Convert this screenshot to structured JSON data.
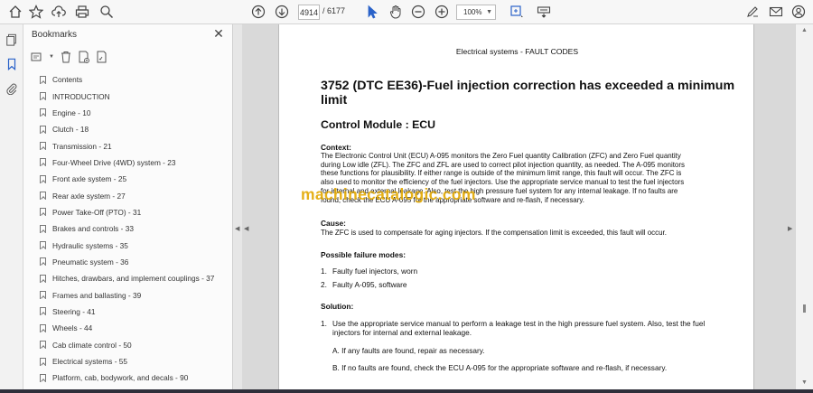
{
  "toolbar": {
    "page_current": "4914",
    "page_total": "/ 6177",
    "zoom": "100%"
  },
  "bookmarks": {
    "title": "Bookmarks",
    "items": [
      "Contents",
      "INTRODUCTION",
      "Engine - 10",
      "Clutch - 18",
      "Transmission - 21",
      "Four-Wheel Drive (4WD) system - 23",
      "Front axle system - 25",
      "Rear axle system - 27",
      "Power Take-Off (PTO) - 31",
      "Brakes and controls - 33",
      "Hydraulic systems - 35",
      "Pneumatic system - 36",
      "Hitches, drawbars, and implement couplings - 37",
      "Frames and ballasting - 39",
      "Steering - 41",
      "Wheels - 44",
      "Cab climate control - 50",
      "Electrical systems - 55",
      "Platform, cab, bodywork, and decals - 90"
    ]
  },
  "document": {
    "header": "Electrical systems - FAULT CODES",
    "title": "3752 (DTC EE36)-Fuel injection correction has exceeded a minimum limit",
    "control_module": "Control Module :  ECU",
    "context_label": "Context:",
    "context_lines": [
      "The Electronic Control Unit (ECU) A-095 monitors the Zero Fuel quantity Calibration (ZFC) and Zero Fuel quantity",
      "during Low idle (ZFL). The ZFC and ZFL are used to correct pilot injection quantity, as needed.  The A-095 monitors",
      "these functions for plausibility.  If either range is outside of the minimum limit range, this fault will occur.  The ZFC is",
      "also used to monitor the efficiency of the fuel injectors.  Use the appropriate service manual to test the fuel injectors",
      "for internal and external leakage.  Also, test the high pressure fuel system for any internal leakage.  If no faults are",
      "found, check the ECU A-095 for the appropriate software and re-flash, if necessary."
    ],
    "cause_label": "Cause:",
    "cause_text": "The ZFC is used to compensate for aging injectors.  If the compensation limit is exceeded, this fault will occur.",
    "failure_label": "Possible failure modes:",
    "failure_modes": [
      {
        "num": "1.",
        "text": "Faulty fuel injectors, worn"
      },
      {
        "num": "2.",
        "text": "Faulty A-095, software"
      }
    ],
    "solution_label": "Solution:",
    "solution_num": "1.",
    "solution_lines": [
      "Use the appropriate service manual to perform a leakage test in the high pressure fuel system.  Also, test the fuel",
      "injectors for internal and external leakage."
    ],
    "sub_a": "A.   If any faults are found, repair as necessary.",
    "sub_b": "B.   If no faults are found, check the ECU A-095 for the appropriate software and re-flash, if necessary.",
    "watermark": "machinecatalogic.com"
  }
}
